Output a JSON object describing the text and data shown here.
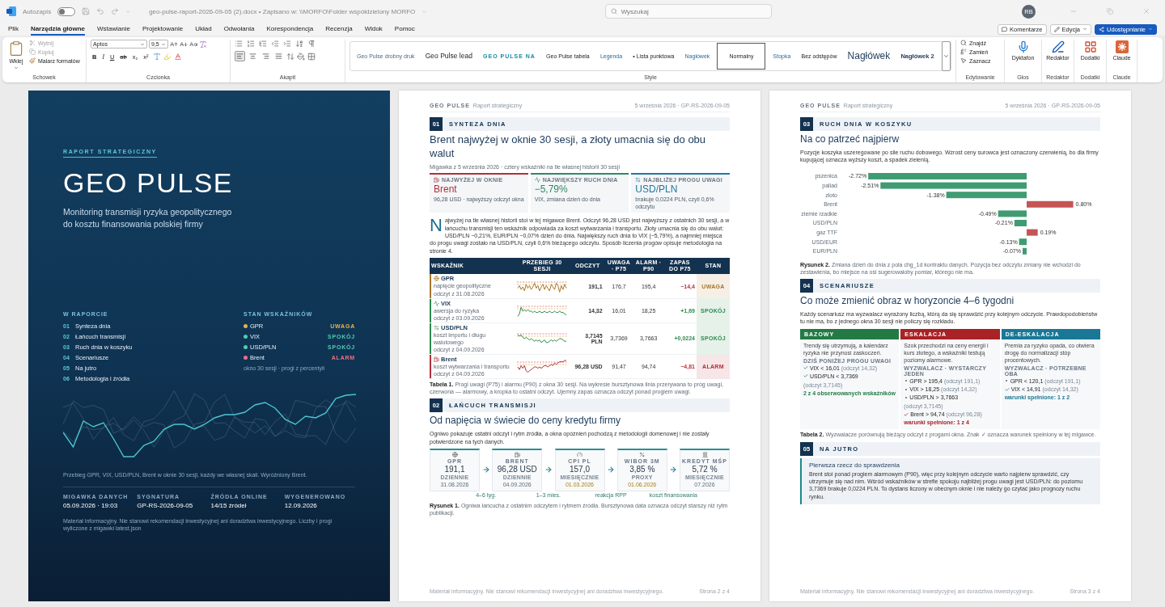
{
  "titlebar": {
    "autosave_label": "Autozapis",
    "autosave_on": false,
    "doc_title": "geo-pulse-raport-2026-09-05 (2).docx • Zapisano w: \\\\MORFO\\Folder współdzielony MORFO",
    "search_placeholder": "Wyszukaj",
    "avatar": "RB"
  },
  "menu_tabs": [
    {
      "label": "Plik",
      "selected": false
    },
    {
      "label": "Narzędzia główne",
      "selected": true
    },
    {
      "label": "Wstawianie",
      "selected": false
    },
    {
      "label": "Projektowanie",
      "selected": false
    },
    {
      "label": "Układ",
      "selected": false
    },
    {
      "label": "Odwołania",
      "selected": false
    },
    {
      "label": "Korespondencja",
      "selected": false
    },
    {
      "label": "Recenzja",
      "selected": false
    },
    {
      "label": "Widok",
      "selected": false
    },
    {
      "label": "Pomoc",
      "selected": false
    }
  ],
  "actions": {
    "comments": "Komentarze",
    "edit": "Edycja",
    "share": "Udostępnianie"
  },
  "ribbon": {
    "clipboard": {
      "paste": "Wklej",
      "items": [
        {
          "label": "Wytnij",
          "disabled": true
        },
        {
          "label": "Kopiuj",
          "disabled": true
        },
        {
          "label": "Malarz formatów",
          "disabled": false
        }
      ],
      "label": "Schowek"
    },
    "font": {
      "name": "Aptos",
      "size": "9,5",
      "format_buttons": [
        {
          "kind": "bold",
          "label": "B"
        },
        {
          "kind": "italic",
          "label": "I"
        },
        {
          "kind": "underline",
          "label": "U"
        },
        {
          "kind": "strike",
          "label": "ab"
        },
        {
          "kind": "sub",
          "label": "x₂"
        },
        {
          "kind": "sup",
          "label": "x²"
        }
      ],
      "label": "Czcionka"
    },
    "paragraph": {
      "alignments": [
        {
          "selected": true
        },
        {
          "selected": false
        },
        {
          "selected": false
        },
        {
          "selected": false
        }
      ],
      "label": "Akapit"
    },
    "styles": {
      "items": [
        {
          "kind": "small",
          "label": "Geo Pulse drobny druk",
          "selected": false
        },
        {
          "kind": "lead",
          "label": "Geo Pulse lead",
          "selected": false
        },
        {
          "kind": "caps",
          "label": "GEO PULSE NA",
          "selected": false
        },
        {
          "kind": "table",
          "label": "Geo Pulse tabela",
          "selected": false
        },
        {
          "kind": "caption",
          "label": "Legenda",
          "selected": false
        },
        {
          "kind": "bullet",
          "label": "• Lista punktowa",
          "selected": false
        },
        {
          "kind": "tiny",
          "label": "Nagłówek",
          "selected": false
        },
        {
          "kind": "normal",
          "label": "Normalny",
          "selected": true
        },
        {
          "kind": "tiny",
          "label": "Stopka",
          "selected": false
        },
        {
          "kind": "normal",
          "label": "Bez odstępów",
          "selected": false
        },
        {
          "kind": "h1",
          "label": "Nagłówek",
          "selected": false
        },
        {
          "kind": "h2",
          "label": "Nagłówek 2",
          "selected": false
        }
      ],
      "label": "Style"
    },
    "editing": {
      "items": [
        "Znajdź",
        "Zamień",
        "Zaznacz"
      ],
      "label": "Edytowanie"
    },
    "big_groups": [
      {
        "button": "Dyktafon",
        "label": "Głos"
      },
      {
        "button": "Redaktor",
        "label": "Redaktor"
      },
      {
        "button": "Dodatki",
        "label": "Dodatki"
      },
      {
        "button": "Claude",
        "label": "Claude"
      }
    ]
  },
  "cover": {
    "eyebrow": "RAPORT STRATEGICZNY",
    "title": "GEO PULSE",
    "subtitle": [
      "Monitoring transmisji ryzyka geopolitycznego",
      "do kosztu finansowania polskiej firmy"
    ],
    "contents_heading": "W RAPORCIE",
    "contents": [
      {
        "num": "01",
        "label": "Synteza dnia"
      },
      {
        "num": "02",
        "label": "Łańcuch transmisji"
      },
      {
        "num": "03",
        "label": "Ruch dnia w koszyku"
      },
      {
        "num": "04",
        "label": "Scenariusze"
      },
      {
        "num": "05",
        "label": "Na jutro"
      },
      {
        "num": "06",
        "label": "Metodologia i źródła"
      }
    ],
    "status_heading": "STAN WSKAŹNIKÓW",
    "status": [
      {
        "name": "GPR",
        "status": "UWAGA",
        "color": "#e2b54a"
      },
      {
        "name": "VIX",
        "status": "SPOKÓJ",
        "color": "#4ecdb0"
      },
      {
        "name": "USD/PLN",
        "status": "SPOKÓJ",
        "color": "#4ecdb0"
      },
      {
        "name": "Brent",
        "status": "ALARM",
        "color": "#f0707e"
      }
    ],
    "status_note": "okno 30 sesji · progi z percentyli",
    "chart_caption": "Przebieg GPR, VIX, USD/PLN, Brent w oknie 30 sesji, każdy we własnej skali. Wyróżniony Brent.",
    "meta": [
      {
        "label": "MIGAWKA DANYCH",
        "value": "05.09.2026 · 19:03"
      },
      {
        "label": "SYGNATURA",
        "value": "GP-RS-2026-09-05"
      },
      {
        "label": "ŹRÓDŁA ONLINE",
        "value": "14/15 źródeł"
      },
      {
        "label": "WYGENEROWANO",
        "value": "12.09.2026"
      }
    ],
    "disclaimer": "Materiał informacyjny. Nie stanowi rekomendacji inwestycyjnej ani doradztwa inwestycyjnego. Liczby i progi wyliczone z migawki latest.json"
  },
  "page2": {
    "brand": "GEO PULSE",
    "brand_sub": "Raport strategiczny",
    "header_right": "5 września 2026 · GP-RS-2026-09-05",
    "section1": {
      "num": "01",
      "title": "SYNTEZA DNIA"
    },
    "headline": "Brent najwyżej w oknie 30 sesji, a złoty umacnia się do obu walut",
    "dateline": "Migawka z 5 września 2026 · cztery wskaźniki na tle własnej historii 30 sesji",
    "kpis": [
      {
        "label": "NAJWYŻEJ W OKNIE",
        "value": "Brent",
        "note": "96,28 USD · najwyższy odczyt okna",
        "color": "#b0303a"
      },
      {
        "label": "NAJWIĘKSZY RUCH DNIA",
        "value": "−5,79%",
        "note": "VIX, zmiana dzień do dnia",
        "color": "#2e8a66"
      },
      {
        "label": "NAJBLIŻEJ PROGU UWAGI",
        "value": "USD/PLN",
        "note": "brakuje 0,0224 PLN, czyli 0,6% odczytu",
        "color": "#1f78a0"
      }
    ],
    "dropcap": "N",
    "lead_text": "ajwyżej na tle własnej historii stoi w tej migawce Brent. Odczyt 96,28 USD jest najwyższy z ostatnich 30 sesji, a w łańcuchu transmisji ten wskaźnik odpowiada za koszt wytwarzania i transportu. Złoty umacnia się do obu walut: USD/PLN −0,21%, EUR/PLN −0,07% dzień do dnia. Największy ruch dnia to VIX (−5,79%), a najmniej miejsca do progu uwagi zostało na USD/PLN, czyli 0,6% bieżącego odczytu. Sposób liczenia progów opisuje metodologia na stronie 4.",
    "table": {
      "columns": [
        "WSKAŹNIK",
        "PRZEBIEG 30 SESJI",
        "ODCZYT",
        "UWAGA · P75",
        "ALARM · P90",
        "ZAPAS DO P75",
        "STAN"
      ],
      "rows": [
        {
          "name": "GPR",
          "desc": "napięcie geopolityczne",
          "date": "odczyt z 31.08.2026",
          "value": "191,1",
          "p75": "176,7",
          "p90": "195,4",
          "margin": "−14,4",
          "margin_negative": true,
          "status": "UWAGA",
          "color": "#a8772a"
        },
        {
          "name": "VIX",
          "desc": "awersja do ryzyka",
          "date": "odczyt z 03.09.2026",
          "value": "14,32",
          "p75": "16,01",
          "p90": "18,25",
          "margin": "+1,69",
          "margin_negative": false,
          "status": "SPOKÓJ",
          "color": "#2e8a4e"
        },
        {
          "name": "USD/PLN",
          "desc": "koszt importu i długu walutowego",
          "date": "odczyt z 04.09.2026",
          "value": "3,7145 PLN",
          "p75": "3,7369",
          "p90": "3,7663",
          "margin": "+0,0224",
          "margin_negative": false,
          "status": "SPOKÓJ",
          "color": "#2e8a4e"
        },
        {
          "name": "Brent",
          "desc": "koszt wytwarzania i transportu",
          "date": "odczyt z 04.09.2026",
          "value": "96,28 USD",
          "p75": "91,47",
          "p90": "94,74",
          "margin": "−4,81",
          "margin_negative": true,
          "status": "ALARM",
          "color": "#b0303a"
        }
      ]
    },
    "table_caption": "**Tabela 1.** Progi uwagi (P75) i alarmu (P90) z okna 30 sesji. Na wykresie bursztynowa linia przerywana to próg uwagi, czerwona — alarmowy, a kropka to ostatni odczyt. Ujemny zapas oznacza odczyt ponad progiem uwagi.",
    "section2": {
      "num": "02",
      "title": "ŁAŃCUCH TRANSMISJI"
    },
    "headline2": "Od napięcia w świecie do ceny kredytu firmy",
    "intro2": "Ogniwo pokazuje ostatni odczyt i rytm źródła, a okna opóźnień pochodzą z metodologii domenowej i nie zostały potwierdzone na tych danych.",
    "chain": [
      {
        "label": "GPR",
        "value": "191,1",
        "freq": "DZIENNIE",
        "date": "31.08.2026",
        "stale": false
      },
      {
        "label": "BRENT",
        "value": "96,28 USD",
        "freq": "DZIENNIE",
        "date": "04.09.2026",
        "stale": false
      },
      {
        "label": "CPI PL",
        "value": "157,0",
        "freq": "MIESIĘCZNIE",
        "date": "01.03.2026",
        "stale": true
      },
      {
        "label": "WIBOR 3M",
        "value": "3,85 %",
        "freq": "PROXY",
        "date": "01.06.2026",
        "stale": true
      },
      {
        "label": "KREDYT MŚP",
        "value": "5,72 %",
        "freq": "MIESIĘCZNIE",
        "date": "07.2026",
        "stale": false
      }
    ],
    "lags": [
      "4–6 tyg.",
      "1–3 mies.",
      "reakcja RPP",
      "koszt finansowania"
    ],
    "figure_caption": "**Rysunek 1.** Ogniwa łańcucha z ostatnim odczytem i rytmem źródła. Bursztynowa data oznacza odczyt starszy niż rytm publikacji.",
    "footer": "Materiał informacyjny. Nie stanowi rekomendacji inwestycyjnej ani doradztwa inwestycyjnego.",
    "page_no": "Strona 2 z 4"
  },
  "page3": {
    "brand": "GEO PULSE",
    "brand_sub": "Raport strategiczny",
    "header_right": "5 września 2026 · GP-RS-2026-09-05",
    "section3": {
      "num": "03",
      "title": "RUCH DNIA W KOSZYKU"
    },
    "headline3": "Na co patrzeć najpierw",
    "intro3": "Pozycje koszyka uszeregowane po sile ruchu dobowego. Wzrost ceny surowca jest oznaczony czerwienią, bo dla firmy kupującej oznacza wyższy koszt, a spadek zielenią.",
    "chart_data": {
      "type": "bar",
      "orientation": "horizontal",
      "categories": [
        "pszenica",
        "pallad",
        "złoto",
        "Brent",
        "ziemie rzadkie",
        "USD/PLN",
        "gaz TTF",
        "USD/EUR",
        "EUR/PLN"
      ],
      "series": [
        {
          "color": "#3f9c72",
          "values": [
            -2.72,
            -2.51,
            -1.38,
            null,
            -0.49,
            -0.21,
            null,
            -0.13,
            -0.07
          ],
          "value_labels": [
            "-2.72%",
            "-2.51%",
            "-1.38%",
            null,
            "-0.49%",
            "-0.21%",
            null,
            "-0.13%",
            "-0.07%"
          ]
        },
        {
          "color": "#c65454",
          "values": [
            null,
            null,
            null,
            0.8,
            null,
            null,
            0.19,
            null,
            null
          ],
          "value_labels": [
            null,
            null,
            null,
            "0.80%",
            null,
            null,
            "0.19%",
            null,
            null
          ]
        }
      ]
    },
    "figure_caption": "**Rysunek 2.** Zmiana dzień do dnia z pola chg_1d kontraktu danych. Pozycja bez odczytu zmiany nie wchodzi do zestawienia, bo miejsce na osi sugerowałoby pomiar, którego nie ma.",
    "section4": {
      "num": "04",
      "title": "SCENARIUSZE"
    },
    "headline4": "Co może zmienić obraz w horyzoncie 4–6 tygodni",
    "intro4": "Każdy scenariusz ma wyzwalacz wyrażony liczbą, którą da się sprawdzić przy kolejnym odczycie. Prawdopodobieństw tu nie ma, bo z jednego okna 30 sesji nie policzy się rozkładu.",
    "scenarios": [
      {
        "title": "BAZOWY",
        "color": "#237a45",
        "desc": "Trendy się utrzymują, a kalendarz ryzyka nie przynosi zaskoczeń.",
        "trigger_label": "DZIŚ PONIŻEJ PROGU UWAGI",
        "triggers": [
          {
            "text": "VIX < 16,01",
            "note": "(odczyt 14,32)",
            "met": true
          },
          {
            "text": "USD/PLN < 3,7369",
            "note": "(odczyt 3,7145)",
            "met": true
          }
        ],
        "summary": "2 z 4 obserwowanych wskaźników"
      },
      {
        "title": "ESKALACJA",
        "color": "#a82226",
        "desc": "Szok przechodzi na ceny energii i kurs złotego, a wskaźniki testują poziomy alarmowe.",
        "trigger_label": "WYZWALACZ · WYSTARCZY JEDEN",
        "triggers": [
          {
            "text": "GPR > 195,4",
            "note": "(odczyt 191,1)",
            "met": false
          },
          {
            "text": "VIX > 18,25",
            "note": "(odczyt 14,32)",
            "met": false
          },
          {
            "text": "USD/PLN > 3,7663",
            "note": "(odczyt 3,7145)",
            "met": false
          },
          {
            "text": "Brent > 94,74",
            "note": "(odczyt 96,28)",
            "met": true
          }
        ],
        "summary": "warunki spełnione: 1 z 4"
      },
      {
        "title": "DE-ESKALACJA",
        "color": "#1a7896",
        "desc": "Premia za ryzyko opada, co otwiera drogę do normalizacji stóp procentowych.",
        "trigger_label": "WYZWALACZ · POTRZEBNE OBA",
        "triggers": [
          {
            "text": "GPR < 120,1",
            "note": "(odczyt 191,1)",
            "met": false
          },
          {
            "text": "VIX < 14,91",
            "note": "(odczyt 14,32)",
            "met": true
          }
        ],
        "summary": "warunki spełnione: 1 z 2"
      }
    ],
    "table_caption": "**Tabela 2.** Wyzwalacze porównują bieżący odczyt z progami okna. Znak ✓ oznacza warunek spełniony w tej migawce.",
    "section5": {
      "num": "05",
      "title": "NA JUTRO"
    },
    "callout_title": "Pierwsza rzecz do sprawdzenia",
    "callout_text": "Brent stoi ponad progiem alarmowym (P90), więc przy kolejnym odczycie warto najpierw sprawdzić, czy utrzymuje się nad nim. Wśród wskaźników w strefie spokoju najbliżej progu uwagi jest USD/PLN: do poziomu 3,7369 brakuje 0,0224 PLN. To dystans liczony w obecnym oknie i nie należy go czytać jako prognozy ruchu rynku.",
    "footer": "Materiał informacyjny. Nie stanowi rekomendacji inwestycyjnej ani doradztwa inwestycyjnego.",
    "page_no": "Strona 3 z 4"
  }
}
